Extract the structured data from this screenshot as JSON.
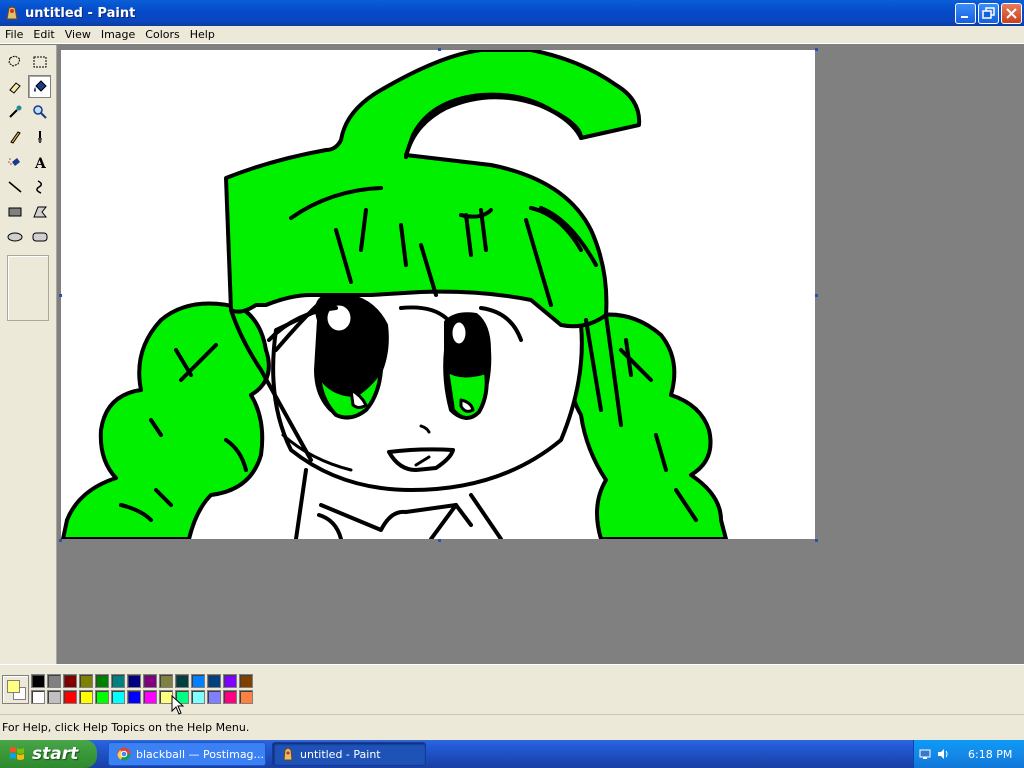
{
  "window": {
    "title": "untitled - Paint"
  },
  "menu": [
    "File",
    "Edit",
    "View",
    "Image",
    "Colors",
    "Help"
  ],
  "tools": [
    {
      "name": "free-form-select-icon"
    },
    {
      "name": "rectangle-select-icon"
    },
    {
      "name": "eraser-icon"
    },
    {
      "name": "fill-with-color-icon",
      "active": true
    },
    {
      "name": "pick-color-icon"
    },
    {
      "name": "magnifier-icon"
    },
    {
      "name": "pencil-icon"
    },
    {
      "name": "brush-icon"
    },
    {
      "name": "airbrush-icon"
    },
    {
      "name": "text-icon"
    },
    {
      "name": "line-icon"
    },
    {
      "name": "curve-icon"
    },
    {
      "name": "rectangle-icon"
    },
    {
      "name": "polygon-icon"
    },
    {
      "name": "ellipse-icon"
    },
    {
      "name": "rounded-rectangle-icon"
    }
  ],
  "colors": {
    "foreground": "#ffff80",
    "background": "#ffffff",
    "drawing_green": "#00f000",
    "palette_top": [
      "#000000",
      "#808080",
      "#800000",
      "#808000",
      "#008000",
      "#008080",
      "#000080",
      "#800080",
      "#808040",
      "#004040",
      "#0080ff",
      "#004080",
      "#8000ff",
      "#804000"
    ],
    "palette_bottom": [
      "#ffffff",
      "#c0c0c0",
      "#ff0000",
      "#ffff00",
      "#00ff00",
      "#00ffff",
      "#0000ff",
      "#ff00ff",
      "#ffff80",
      "#00ff80",
      "#80ffff",
      "#8080ff",
      "#ff0080",
      "#ff8040"
    ]
  },
  "status": {
    "text": "For Help, click Help Topics on the Help Menu."
  },
  "taskbar": {
    "start_label": "start",
    "items": [
      {
        "label": "blackball — Postimag...",
        "icon": "chrome-icon",
        "active": false
      },
      {
        "label": "untitled - Paint",
        "icon": "paint-icon",
        "active": true
      }
    ],
    "clock": "6:18 PM"
  }
}
